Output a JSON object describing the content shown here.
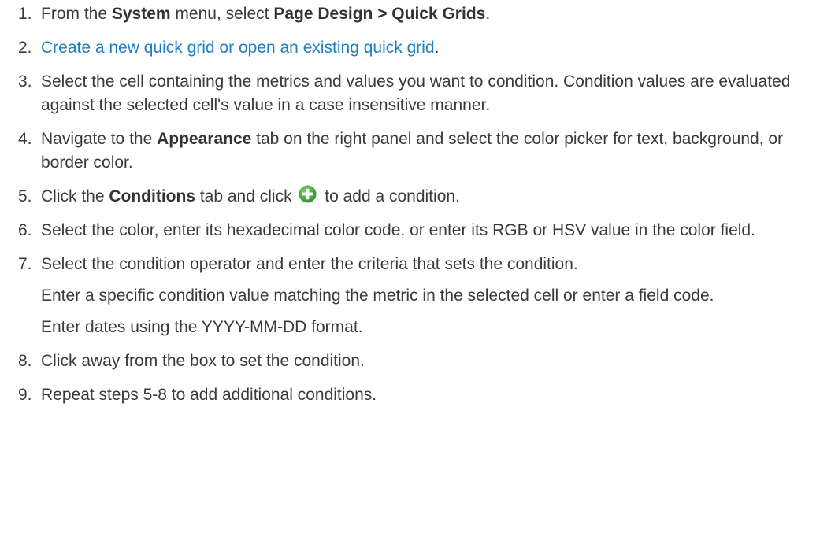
{
  "steps": [
    {
      "num": "1.",
      "p1_pre": "From the ",
      "p1_b1": "System",
      "p1_mid": " menu, select ",
      "p1_b2": "Page Design > Quick Grids",
      "p1_end": "."
    },
    {
      "num": "2.",
      "link": "Create a new quick grid or open an existing quick grid",
      "end": "."
    },
    {
      "num": "3.",
      "text": "Select the cell containing the metrics and values you want to condition. Condition values are evaluated against the selected cell's value in a case insensitive manner."
    },
    {
      "num": "4.",
      "pre": "Navigate to the ",
      "bold": "Appearance",
      "post": " tab on the right panel and select the color picker for text, background, or border color."
    },
    {
      "num": "5.",
      "pre": "Click the ",
      "bold": "Conditions",
      "mid": " tab and click ",
      "icon": "add-condition-plus-icon",
      "post": " to add a condition."
    },
    {
      "num": "6.",
      "text": "Select the color, enter its hexadecimal color code, or enter its RGB or HSV value in the color field."
    },
    {
      "num": "7.",
      "text": "Select the condition operator and enter the criteria that sets the condition.",
      "sub1": "Enter a specific condition value matching the metric in the selected cell or enter a field code.",
      "sub2": "Enter dates using the YYYY-MM-DD format."
    },
    {
      "num": "8.",
      "text": "Click away from the box to set the condition."
    },
    {
      "num": "9.",
      "text": "Repeat steps 5-8 to add additional conditions."
    }
  ],
  "colors": {
    "text": "#3a3a3a",
    "link": "#1f7ec1",
    "icon_green": "#3fa535"
  }
}
